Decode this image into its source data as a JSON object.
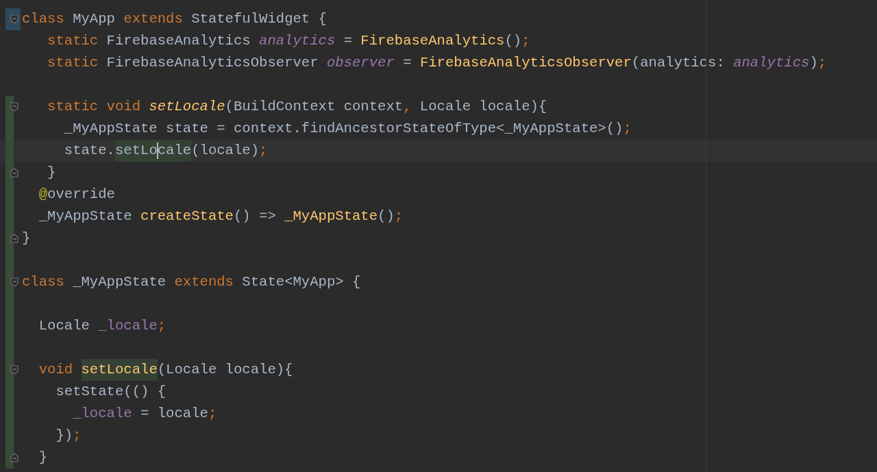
{
  "editor": {
    "lines": [
      {
        "modified": true,
        "added": false,
        "fold_start": true,
        "fold_end": false,
        "tokens": [
          {
            "t": "class",
            "kind": "kw",
            "highlighted": false
          },
          {
            "t": " MyApp ",
            "kind": "plain",
            "highlighted": false
          },
          {
            "t": "extends",
            "kind": "kw",
            "highlighted": false
          },
          {
            "t": " StatefulWidget {",
            "kind": "plain",
            "highlighted": false
          }
        ]
      },
      {
        "modified": false,
        "added": false,
        "fold_start": false,
        "fold_end": false,
        "tokens": [
          {
            "t": "   static",
            "kind": "kw",
            "highlighted": false
          },
          {
            "t": " FirebaseAnalytics ",
            "kind": "plain",
            "highlighted": false
          },
          {
            "t": "analytics",
            "kind": "field_italic",
            "highlighted": false
          },
          {
            "t": " = ",
            "kind": "plain",
            "highlighted": false
          },
          {
            "t": "FirebaseAnalytics",
            "kind": "fn",
            "highlighted": false
          },
          {
            "t": "()",
            "kind": "plain",
            "highlighted": false
          },
          {
            "t": ";",
            "kind": "punct",
            "highlighted": false
          }
        ]
      },
      {
        "modified": false,
        "added": false,
        "fold_start": false,
        "fold_end": false,
        "tokens": [
          {
            "t": "   static",
            "kind": "kw",
            "highlighted": false
          },
          {
            "t": " FirebaseAnalyticsObserver ",
            "kind": "plain",
            "highlighted": false
          },
          {
            "t": "observer",
            "kind": "field_italic",
            "highlighted": false
          },
          {
            "t": " = ",
            "kind": "plain",
            "highlighted": false
          },
          {
            "t": "FirebaseAnalyticsObserver",
            "kind": "fn",
            "highlighted": false
          },
          {
            "t": "(analytics: ",
            "kind": "plain",
            "highlighted": false
          },
          {
            "t": "analytics",
            "kind": "field_italic",
            "highlighted": false
          },
          {
            "t": ")",
            "kind": "plain",
            "highlighted": false
          },
          {
            "t": ";",
            "kind": "punct",
            "highlighted": false
          }
        ]
      },
      {
        "modified": false,
        "added": false,
        "fold_start": false,
        "fold_end": false
      },
      {
        "modified": false,
        "added": true,
        "fold_start": true,
        "fold_end": false,
        "tokens": [
          {
            "t": "   static void ",
            "kind": "kw",
            "highlighted": false
          },
          {
            "t": "setLocale",
            "kind": "fn_italic",
            "highlighted": false
          },
          {
            "t": "(BuildContext context",
            "kind": "plain",
            "highlighted": false
          },
          {
            "t": ",",
            "kind": "punct",
            "highlighted": false
          },
          {
            "t": " Locale locale){",
            "kind": "plain",
            "highlighted": false
          }
        ]
      },
      {
        "modified": false,
        "added": true,
        "fold_start": false,
        "fold_end": false,
        "tokens": [
          {
            "t": "     _MyAppState state = context.findAncestorStateOfType<_MyAppState>()",
            "kind": "plain",
            "highlighted": false
          },
          {
            "t": ";",
            "kind": "punct",
            "highlighted": false
          }
        ]
      },
      {
        "modified": false,
        "added": true,
        "fold_start": false,
        "fold_end": false,
        "tokens": [
          {
            "t": "     state.",
            "kind": "plain",
            "highlighted": false
          },
          {
            "t": "setLo",
            "kind": "plain",
            "highlighted": true
          },
          {
            "kind": "caret"
          },
          {
            "t": "cale",
            "kind": "plain",
            "highlighted": true
          },
          {
            "t": "(locale)",
            "kind": "plain",
            "highlighted": false
          },
          {
            "t": ";",
            "kind": "punct",
            "highlighted": false
          }
        ]
      },
      {
        "modified": false,
        "added": true,
        "fold_start": false,
        "fold_end": true,
        "tokens": [
          {
            "t": "   }",
            "kind": "plain",
            "highlighted": false
          }
        ]
      },
      {
        "modified": false,
        "added": true,
        "fold_start": false,
        "fold_end": false,
        "tokens": [
          {
            "t": "  @",
            "kind": "annot",
            "highlighted": false
          },
          {
            "t": "override",
            "kind": "plain",
            "highlighted": false
          }
        ]
      },
      {
        "modified": false,
        "added": true,
        "fold_start": false,
        "fold_end": false,
        "tokens": [
          {
            "t": "  _MyAppState ",
            "kind": "plain",
            "highlighted": false
          },
          {
            "t": "createState",
            "kind": "fn",
            "highlighted": false
          },
          {
            "t": "() => ",
            "kind": "plain",
            "highlighted": false
          },
          {
            "t": "_MyAppState",
            "kind": "fn",
            "highlighted": false
          },
          {
            "t": "()",
            "kind": "plain",
            "highlighted": false
          },
          {
            "t": ";",
            "kind": "punct",
            "highlighted": false
          }
        ]
      },
      {
        "modified": false,
        "added": true,
        "fold_start": false,
        "fold_end": true,
        "tokens": [
          {
            "t": "}",
            "kind": "plain",
            "highlighted": false
          }
        ]
      },
      {
        "modified": false,
        "added": true,
        "fold_start": false,
        "fold_end": false
      },
      {
        "modified": false,
        "added": true,
        "fold_start": true,
        "fold_end": false,
        "tokens": [
          {
            "t": "class",
            "kind": "kw",
            "highlighted": false
          },
          {
            "t": " _MyAppState ",
            "kind": "plain",
            "highlighted": false
          },
          {
            "t": "extends",
            "kind": "kw",
            "highlighted": false
          },
          {
            "t": " State<MyApp> {",
            "kind": "plain",
            "highlighted": false
          }
        ]
      },
      {
        "modified": false,
        "added": true,
        "fold_start": false,
        "fold_end": false
      },
      {
        "modified": false,
        "added": true,
        "fold_start": false,
        "fold_end": false,
        "tokens": [
          {
            "t": "  Locale ",
            "kind": "plain",
            "highlighted": false
          },
          {
            "t": "_locale",
            "kind": "field",
            "highlighted": false
          },
          {
            "t": ";",
            "kind": "punct",
            "highlighted": false
          }
        ]
      },
      {
        "modified": false,
        "added": true,
        "fold_start": false,
        "fold_end": false
      },
      {
        "modified": false,
        "added": true,
        "fold_start": true,
        "fold_end": false,
        "tokens": [
          {
            "t": "  void ",
            "kind": "kw",
            "highlighted": false
          },
          {
            "t": "setLocale",
            "kind": "fn",
            "highlighted": true
          },
          {
            "t": "(Locale locale){",
            "kind": "plain",
            "highlighted": false
          }
        ]
      },
      {
        "modified": false,
        "added": true,
        "fold_start": false,
        "fold_end": false,
        "tokens": [
          {
            "t": "    setState(() {",
            "kind": "plain",
            "highlighted": false
          }
        ]
      },
      {
        "modified": false,
        "added": true,
        "fold_start": false,
        "fold_end": false,
        "tokens": [
          {
            "t": "      _locale",
            "kind": "field",
            "highlighted": false
          },
          {
            "t": " = locale",
            "kind": "plain",
            "highlighted": false
          },
          {
            "t": ";",
            "kind": "punct",
            "highlighted": false
          }
        ]
      },
      {
        "modified": false,
        "added": true,
        "fold_start": false,
        "fold_end": false,
        "tokens": [
          {
            "t": "    })",
            "kind": "plain",
            "highlighted": false
          },
          {
            "t": ";",
            "kind": "punct",
            "highlighted": false
          }
        ]
      },
      {
        "modified": false,
        "added": true,
        "fold_start": false,
        "fold_end": true,
        "tokens": [
          {
            "t": "  }",
            "kind": "plain",
            "highlighted": false
          }
        ]
      }
    ]
  }
}
